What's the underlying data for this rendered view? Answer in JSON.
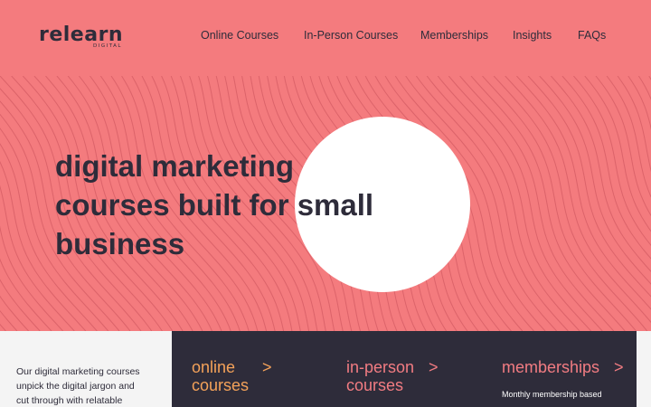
{
  "logo": {
    "text": "relearn",
    "sub": "DIGITAL"
  },
  "nav": {
    "items": [
      {
        "label": "Online Courses"
      },
      {
        "label": "In-Person Courses"
      },
      {
        "label": "Memberships"
      },
      {
        "label": "Insights"
      },
      {
        "label": "FAQs"
      }
    ]
  },
  "hero": {
    "line1": "digital marketing",
    "line2": "courses built for small",
    "line3": "business"
  },
  "intro": {
    "line1": "Our digital marketing courses",
    "line2": "unpick the digital jargon and",
    "line3": "cut through with relatable"
  },
  "cards": {
    "online": {
      "line1": "online",
      "line2": "courses",
      "chevron": ">"
    },
    "inperson": {
      "line1": "in-person",
      "line2": "courses",
      "chevron": ">"
    },
    "memberships": {
      "line1": "memberships",
      "chevron": ">",
      "sub": "Monthly membership based"
    }
  },
  "colors": {
    "coral": "#f47b7e",
    "dark": "#2e2c3a",
    "orange": "#f4a259",
    "pink": "#f27c82",
    "light": "#f4f4f4"
  }
}
